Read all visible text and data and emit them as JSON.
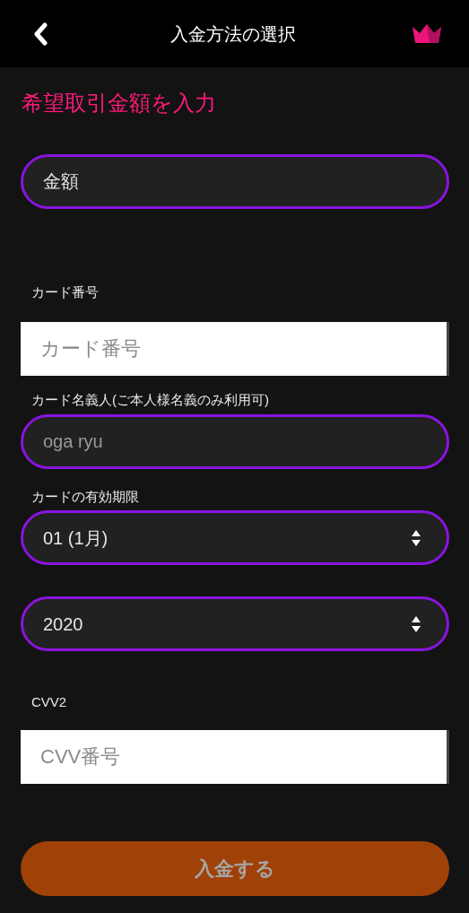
{
  "header": {
    "title": "入金方法の選択"
  },
  "heading": "希望取引金額を入力",
  "fields": [
    {
      "kind": "input",
      "placeholder": "金額"
    },
    {
      "kind": "boxed_input",
      "label": "カード番号",
      "placeholder": "カード番号"
    },
    {
      "kind": "input",
      "label": "カード名義人(ご本人様名義のみ利用可)",
      "placeholder": "oga ryu"
    },
    {
      "kind": "select",
      "label": "カードの有効期限",
      "value": "01 (1月)"
    },
    {
      "kind": "select",
      "value": "2020"
    },
    {
      "kind": "boxed_input",
      "label": "CVV2",
      "placeholder": "CVV番号"
    }
  ],
  "submit": {
    "label": "入金する",
    "disabled": true
  }
}
